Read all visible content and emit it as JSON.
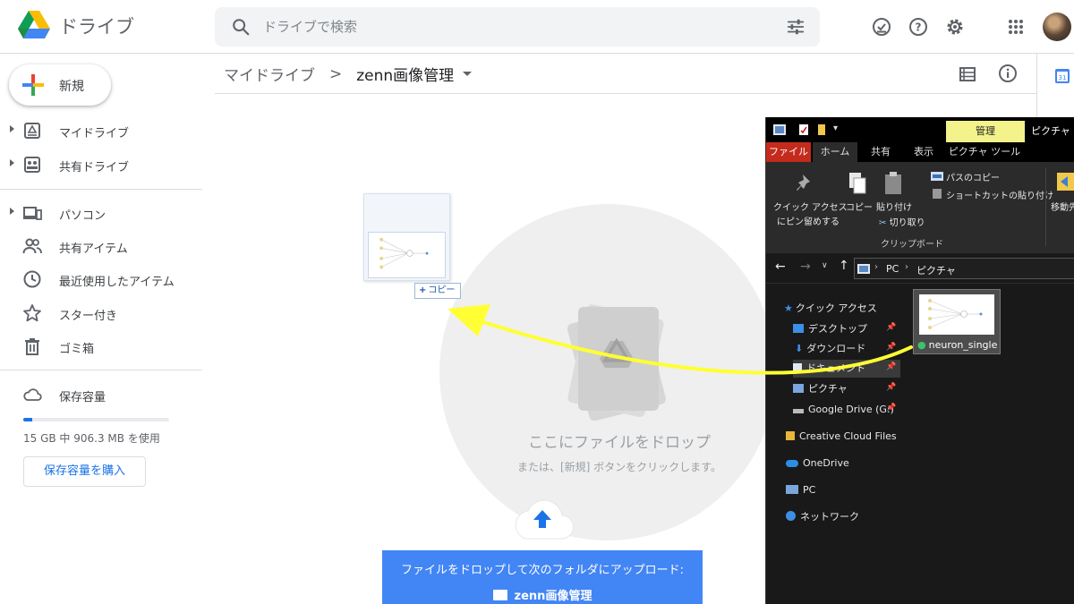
{
  "app": {
    "title": "ドライブ"
  },
  "search": {
    "placeholder": "ドライブで検索"
  },
  "sidebar": {
    "new_label": "新規",
    "items": [
      {
        "label": "マイドライブ",
        "icon": "my-drive-icon",
        "expandable": true
      },
      {
        "label": "共有ドライブ",
        "icon": "shared-drives-icon",
        "expandable": true
      },
      {
        "label": "パソコン",
        "icon": "computers-icon",
        "expandable": true
      },
      {
        "label": "共有アイテム",
        "icon": "shared-with-me-icon",
        "expandable": false
      },
      {
        "label": "最近使用したアイテム",
        "icon": "recent-icon",
        "expandable": false
      },
      {
        "label": "スター付き",
        "icon": "star-icon",
        "expandable": false
      },
      {
        "label": "ゴミ箱",
        "icon": "trash-icon",
        "expandable": false
      },
      {
        "label": "保存容量",
        "icon": "cloud-icon",
        "expandable": false
      }
    ],
    "storage": {
      "text": "15 GB 中 906.3 MB を使用",
      "used_fraction": 0.06,
      "buy_label": "保存容量を購入"
    }
  },
  "breadcrumb": {
    "root": "マイドライブ",
    "separator": ">",
    "current": "zenn画像管理"
  },
  "dropzone": {
    "title": "ここにファイルをドロップ",
    "subtitle": "または、[新規] ボタンをクリックします。",
    "banner_line1": "ファイルをドロップして次のフォルダにアップロード:",
    "banner_folder": "zenn画像管理"
  },
  "drag": {
    "copy_label": "コピー"
  },
  "explorer": {
    "manage_label": "管理",
    "window_title": "ピクチャ",
    "tabs": [
      "ファイル",
      "ホーム",
      "共有",
      "表示",
      "ピクチャ ツール"
    ],
    "ribbon": {
      "pin_label_1": "クイック アクセス",
      "pin_label_2": "にピン留めする",
      "copy": "コピー",
      "paste": "貼り付け",
      "copy_path": "パスのコピー",
      "paste_shortcut": "ショートカットの貼り付け",
      "cut": "切り取り",
      "group": "クリップボード",
      "move": "移動先"
    },
    "path": [
      "PC",
      "ピクチャ"
    ],
    "nav": [
      {
        "label": "クイック アクセス",
        "pinned": false
      },
      {
        "label": "デスクトップ",
        "pinned": true
      },
      {
        "label": "ダウンロード",
        "pinned": true
      },
      {
        "label": "ドキュメント",
        "pinned": true
      },
      {
        "label": "ピクチャ",
        "pinned": true
      },
      {
        "label": "Google Drive (G:)",
        "pinned": true
      },
      {
        "label": "Creative Cloud Files",
        "pinned": false
      },
      {
        "label": "OneDrive",
        "pinned": false
      },
      {
        "label": "PC",
        "pinned": false
      },
      {
        "label": "ネットワーク",
        "pinned": false
      }
    ],
    "file": {
      "name": "neuron_single"
    }
  },
  "colors": {
    "accent": "#1a73e8",
    "banner": "#4285f4",
    "arrow": "#ffff33",
    "manage_tab": "#f3f28b",
    "file_tab": "#c42b1c"
  }
}
